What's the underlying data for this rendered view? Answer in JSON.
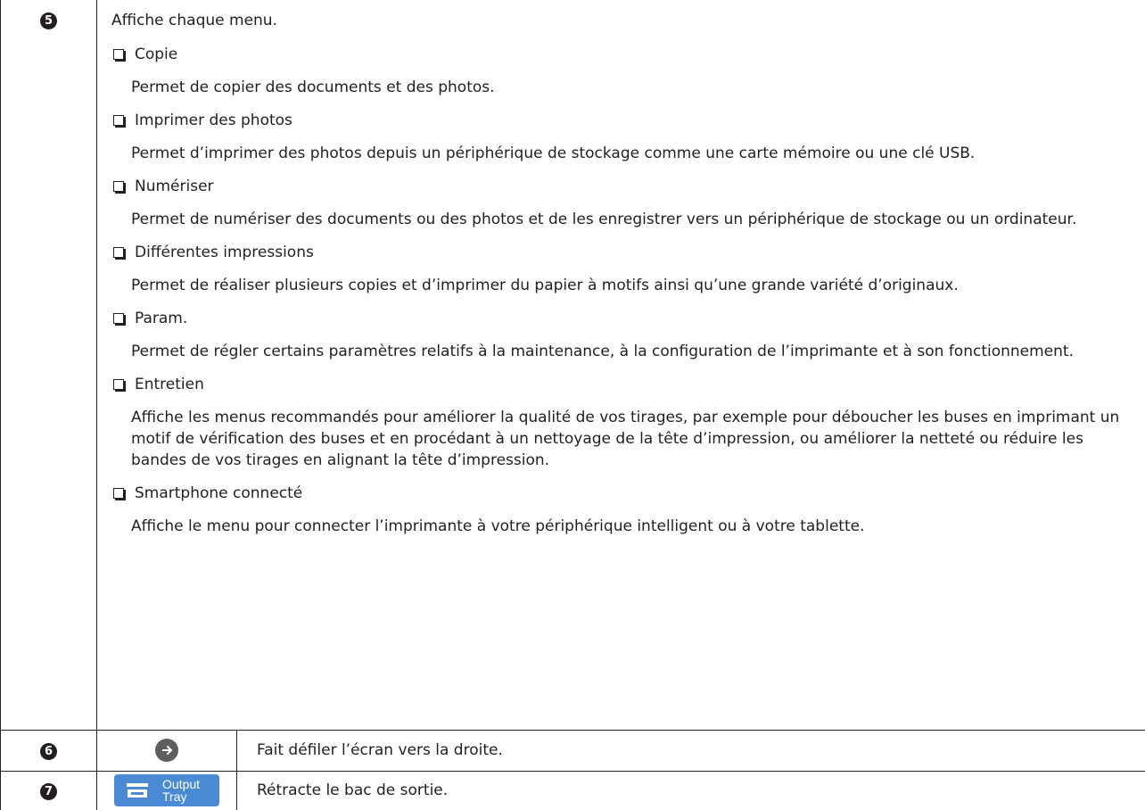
{
  "rows": [
    {
      "number": "5",
      "intro": "Affiche chaque menu.",
      "items": [
        {
          "title": "Copie",
          "description": "Permet de copier des documents et des photos."
        },
        {
          "title": "Imprimer des photos",
          "description": "Permet d’imprimer des photos depuis un périphérique de stockage comme une carte mémoire ou une clé USB."
        },
        {
          "title": "Numériser",
          "description": "Permet de numériser des documents ou des photos et de les enregistrer vers un périphérique de stockage ou un ordinateur."
        },
        {
          "title": "Différentes impressions",
          "description": "Permet de réaliser plusieurs copies et d’imprimer du papier à motifs ainsi qu’une grande variété d’originaux."
        },
        {
          "title": "Param.",
          "description": "Permet de régler certains paramètres relatifs à la maintenance, à la configuration de l’imprimante et à son fonctionnement."
        },
        {
          "title": "Entretien",
          "description": "Affiche les menus recommandés pour améliorer la qualité de vos tirages, par exemple pour déboucher les buses en imprimant un motif de vérification des buses et en procédant à un nettoyage de la tête d’impression, ou améliorer la netteté ou réduire les bandes de vos tirages en alignant la tête d’impression."
        },
        {
          "title": "Smartphone connecté",
          "description": "Affiche le menu pour connecter l’imprimante à votre périphérique intelligent ou à votre tablette."
        }
      ]
    },
    {
      "number": "6",
      "icon": "right-arrow-icon",
      "text": "Fait défiler l’écran vers la droite."
    },
    {
      "number": "7",
      "button_label": "Output Tray",
      "button_line1": "Output",
      "button_line2": "Tray",
      "text": "Rétracte le bac de sortie."
    }
  ],
  "colors": {
    "text": "#231f20",
    "tray_button": "#4a8ad4",
    "arrow_button": "#5e5e5e"
  }
}
